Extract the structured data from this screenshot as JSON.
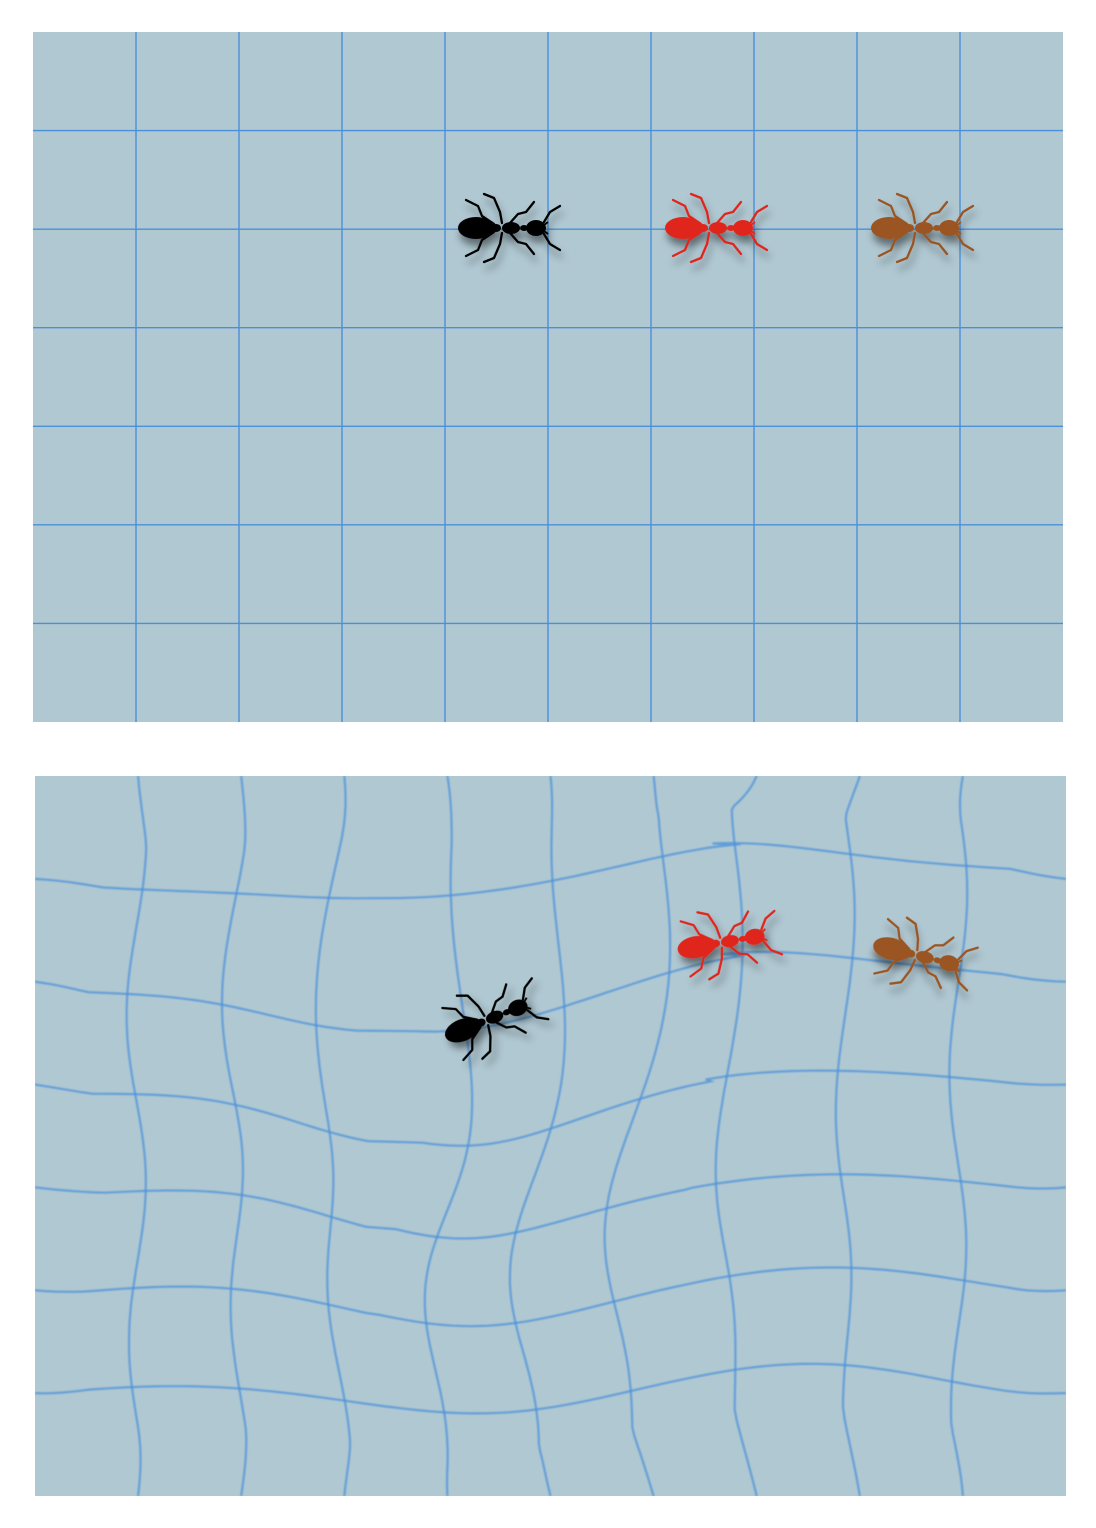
{
  "colors": {
    "background": "#b0c8d2",
    "grid_line": "#4a90d9",
    "ant_black": "#000000",
    "ant_red": "#e0281f",
    "ant_brown": "#9b5420"
  },
  "panels": [
    {
      "id": "flat-grid",
      "grid": {
        "columns": 10,
        "rows": 7,
        "warped": false
      },
      "ants": [
        {
          "id": "black-ant",
          "color": "#000000"
        },
        {
          "id": "red-ant",
          "color": "#e0281f"
        },
        {
          "id": "brown-ant",
          "color": "#9b5420"
        }
      ]
    },
    {
      "id": "warped-grid",
      "grid": {
        "columns": 10,
        "rows": 7,
        "warped": true
      },
      "ants": [
        {
          "id": "black-ant",
          "color": "#000000"
        },
        {
          "id": "red-ant",
          "color": "#e0281f"
        },
        {
          "id": "brown-ant",
          "color": "#9b5420"
        }
      ]
    }
  ]
}
